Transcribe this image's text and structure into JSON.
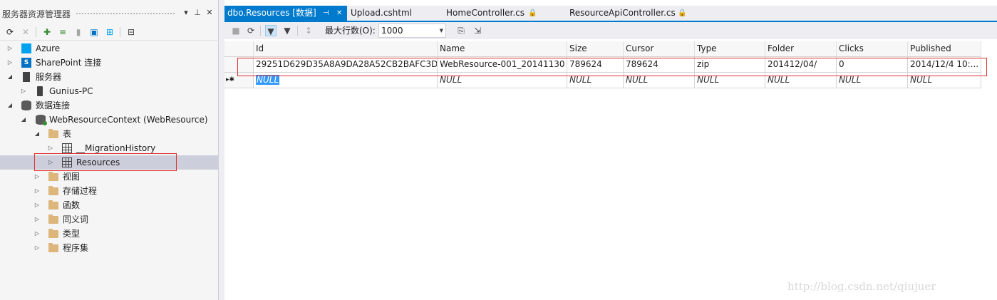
{
  "server_explorer": {
    "title": "服务器资源管理器",
    "tree": [
      {
        "label": "Azure"
      },
      {
        "label": "SharePoint 连接"
      },
      {
        "label": "服务器"
      },
      {
        "label": "Gunius-PC"
      },
      {
        "label": "数据连接"
      },
      {
        "label": "WebResourceContext (WebResource)"
      },
      {
        "label": "表"
      },
      {
        "label": "__MigrationHistory"
      },
      {
        "label": "Resources"
      },
      {
        "label": "视图"
      },
      {
        "label": "存储过程"
      },
      {
        "label": "函数"
      },
      {
        "label": "同义词"
      },
      {
        "label": "类型"
      },
      {
        "label": "程序集"
      }
    ]
  },
  "tabs": [
    {
      "label": "dbo.Resources [数据]",
      "active": true
    },
    {
      "label": "Upload.cshtml"
    },
    {
      "label": "HomeController.cs"
    },
    {
      "label": "ResourceApiController.cs"
    }
  ],
  "doc_toolbar": {
    "max_rows_label": "最大行数(O):",
    "max_rows_value": "1000"
  },
  "grid": {
    "columns": [
      "Id",
      "Name",
      "Size",
      "Cursor",
      "Type",
      "Folder",
      "Clicks",
      "Published"
    ],
    "rows": [
      [
        "29251D629D35A8A9DA28A52CB2BAFC3D",
        "WebResource-001_20141130",
        "789624",
        "789624",
        "zip",
        "201412/04/",
        "0",
        "2014/12/4 10:..."
      ]
    ],
    "new_row": [
      "NULL",
      "NULL",
      "NULL",
      "NULL",
      "NULL",
      "NULL",
      "NULL",
      "NULL"
    ]
  },
  "watermark": "http://blog.csdn.net/qiujuer"
}
